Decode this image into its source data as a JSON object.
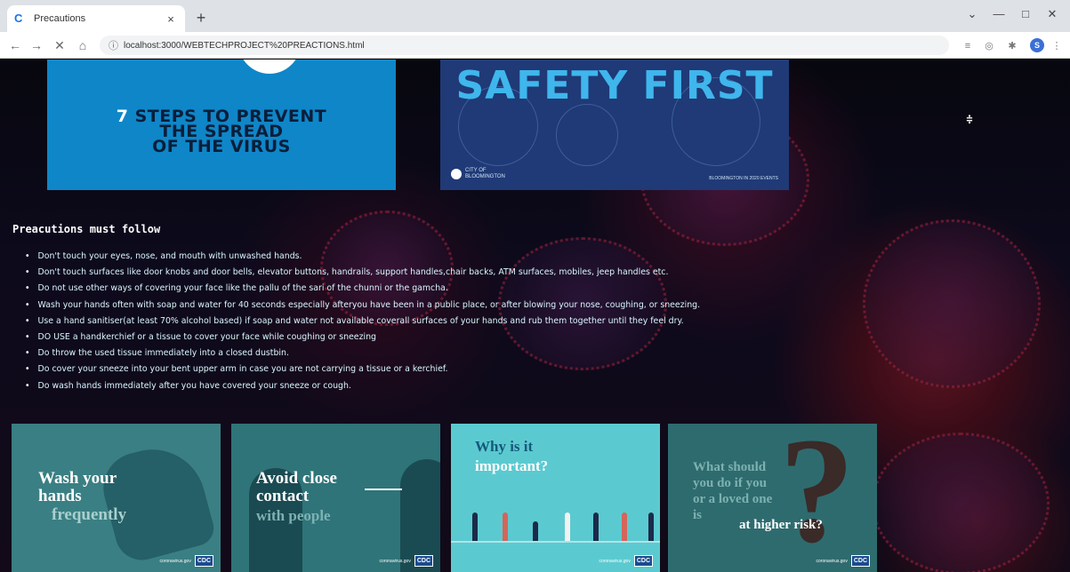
{
  "browser": {
    "tab_title": "Precautions",
    "tab_favicon": "C",
    "tab_close": "×",
    "new_tab": "+",
    "url": "localhost:3000/WEBTECHPROJECT%20PREACTIONS.html",
    "nav": {
      "back": "←",
      "forward": "→",
      "reload": "✕",
      "home": "⌂"
    },
    "window": {
      "minimize": "—",
      "maximize": "□",
      "close": "✕",
      "dropdown": "⌄"
    },
    "profile_initial": "S"
  },
  "banners": {
    "first": {
      "number": "7",
      "text": "STEPS TO PREVENT\nTHE SPREAD\nOF THE VIRUS"
    },
    "second": {
      "title": "SAFETY FIRST",
      "city": "CITY OF\nBLOOMINGTON",
      "footer": "BLOOMINGTON IN 2020 EVENTS"
    }
  },
  "precautions": {
    "heading": "Preacutions must follow",
    "items": [
      "Don't touch your eyes, nose, and mouth with unwashed hands.",
      "Don't touch surfaces like door knobs and door bells, elevator buttons, handrails, support handles,chair backs, ATM surfaces, mobiles, jeep handles etc.",
      "Do not use other ways of covering your face like the pallu of the sari of the chunni or the gamcha.",
      "Wash your hands often with soap and water for 40 seconds especially afteryou have been in a public place, or after blowing your nose, coughing, or sneezing.",
      "Use a hand sanitiser(at least 70% alcohol based) if soap and water not available coverall surfaces of your hands and rub them together until they feel dry.",
      "DO USE a handkerchief or a tissue to cover your face while coughing or sneezing",
      "Do throw the used tissue immediately into a closed dustbin.",
      "Do cover your sneeze into your bent upper arm in case you are not carrying a tissue or a kerchief.",
      "Do wash hands immediately after you have covered your sneeze or cough."
    ]
  },
  "cards": [
    {
      "line1": "Wash your\nhands",
      "line2": "frequently",
      "cdc_url": "coronavirus.gov",
      "cdc": "CDC"
    },
    {
      "line1": "Avoid close\ncontact",
      "line2": "with people",
      "cdc_url": "coronavirus.gov",
      "cdc": "CDC"
    },
    {
      "line1": "Why is it",
      "line2": "important?",
      "cdc_url": "coronavirus.gov",
      "cdc": "CDC"
    },
    {
      "line1": "What should\nyou do if you\nor a loved one\nis",
      "line2": "at higher risk?",
      "cdc_url": "coronavirus.gov",
      "cdc": "CDC"
    }
  ],
  "colors": {
    "banner_blue": "#0f86c8",
    "banner_navy": "#1f3a76",
    "safety_text": "#3fb6ec",
    "list_text": "#d9f5ff",
    "card_teal": "#3a7f83",
    "card_light": "#5bcad0"
  }
}
